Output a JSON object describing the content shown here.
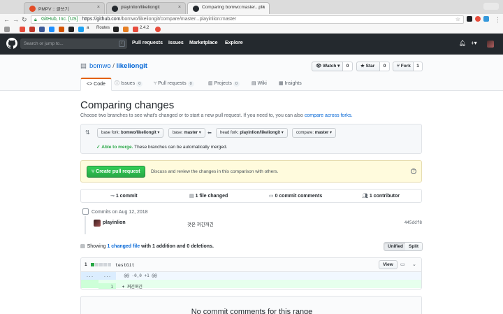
{
  "browser": {
    "tabs": [
      {
        "title": "PMPV :: 글쓰기",
        "icon_color": "#e34c26"
      },
      {
        "title": "playinlion/likeliongit",
        "icon_color": "#24292e"
      },
      {
        "title": "Comparing bomwo:master...pla",
        "icon_color": "#24292e"
      }
    ],
    "secure_label": "GitHub, Inc. [US]",
    "url_main": "https://github.com",
    "url_path": "/bomwo/likeliongit/compare/master...playinlion:master",
    "bookmarks": [
      {
        "label": "",
        "color": "#e74c3c"
      },
      {
        "label": "",
        "color": "#c0392b"
      },
      {
        "label": "",
        "color": "#3b5998"
      },
      {
        "label": "",
        "color": "#1e90ff"
      },
      {
        "label": "",
        "color": "#d35400"
      },
      {
        "label": "",
        "color": "#222222"
      },
      {
        "label": "",
        "color": "#1da1f2"
      },
      {
        "label": "a",
        "color": ""
      },
      {
        "label": "Routes",
        "color": ""
      },
      {
        "label": "2.4.2",
        "color": "#e74c3c"
      }
    ]
  },
  "gh_header": {
    "search_placeholder": "Search or jump to...",
    "search_key": "/",
    "nav": [
      "Pull requests",
      "Issues",
      "Marketplace",
      "Explore"
    ],
    "icons": [
      "bell-icon",
      "plus-icon",
      "avatar"
    ]
  },
  "repo": {
    "owner": "bomwo",
    "name": "likeliongit",
    "watch_label": "Watch ▾",
    "watch_count": "0",
    "star_label": "Star",
    "star_count": "0",
    "fork_label": "Fork",
    "fork_count": "1",
    "tabs": [
      {
        "label": "Code",
        "count": ""
      },
      {
        "label": "Issues",
        "count": "0"
      },
      {
        "label": "Pull requests",
        "count": "0"
      },
      {
        "label": "Projects",
        "count": "0"
      },
      {
        "label": "Wiki",
        "count": ""
      },
      {
        "label": "Insights",
        "count": ""
      }
    ]
  },
  "compare": {
    "title": "Comparing changes",
    "subtitle": "Choose two branches to see what's changed or to start a new pull request. If you need to, you can also",
    "subtitle_link": "compare across forks.",
    "base_fork_label": "base fork:",
    "base_fork": "bomwo/likeliongit",
    "base_label": "base:",
    "base": "master",
    "head_fork_label": "head fork:",
    "head_fork": "playinlion/likeliongit",
    "compare_label": "compare:",
    "compare": "master",
    "merge_ok": "Able to merge.",
    "merge_text": "These branches can be automatically merged.",
    "create_pr": "Create pull request",
    "pr_hint": "Discuss and review the changes in this comparison with others."
  },
  "stats": {
    "commits": "1 commit",
    "files": "1 file changed",
    "comments": "0 commit comments",
    "contributors": "1 contributor"
  },
  "commits": {
    "date_label": "Commits on Aug 12, 2018",
    "items": [
      {
        "author": "playinlion",
        "message": "것은 꺼긴꺼긴",
        "sha": "445ddf8"
      }
    ]
  },
  "diff": {
    "showing_prefix": "Showing",
    "showing_link": "1 changed file",
    "showing_suffix": "with 1 addition and 0 deletions.",
    "unified": "Unified",
    "split": "Split",
    "file_count": "1",
    "file_name": "testGit",
    "view": "View",
    "hunk_ln": "...",
    "hunk_header": "@@ -0,0 +1 @@",
    "added_ln": "1",
    "added_code": "+ 꺼긴꺼긴",
    "colors": {
      "add": "#28a745",
      "neutral": "#d1d5da"
    }
  },
  "footer": {
    "no_comments": "No commit comments for this range"
  }
}
